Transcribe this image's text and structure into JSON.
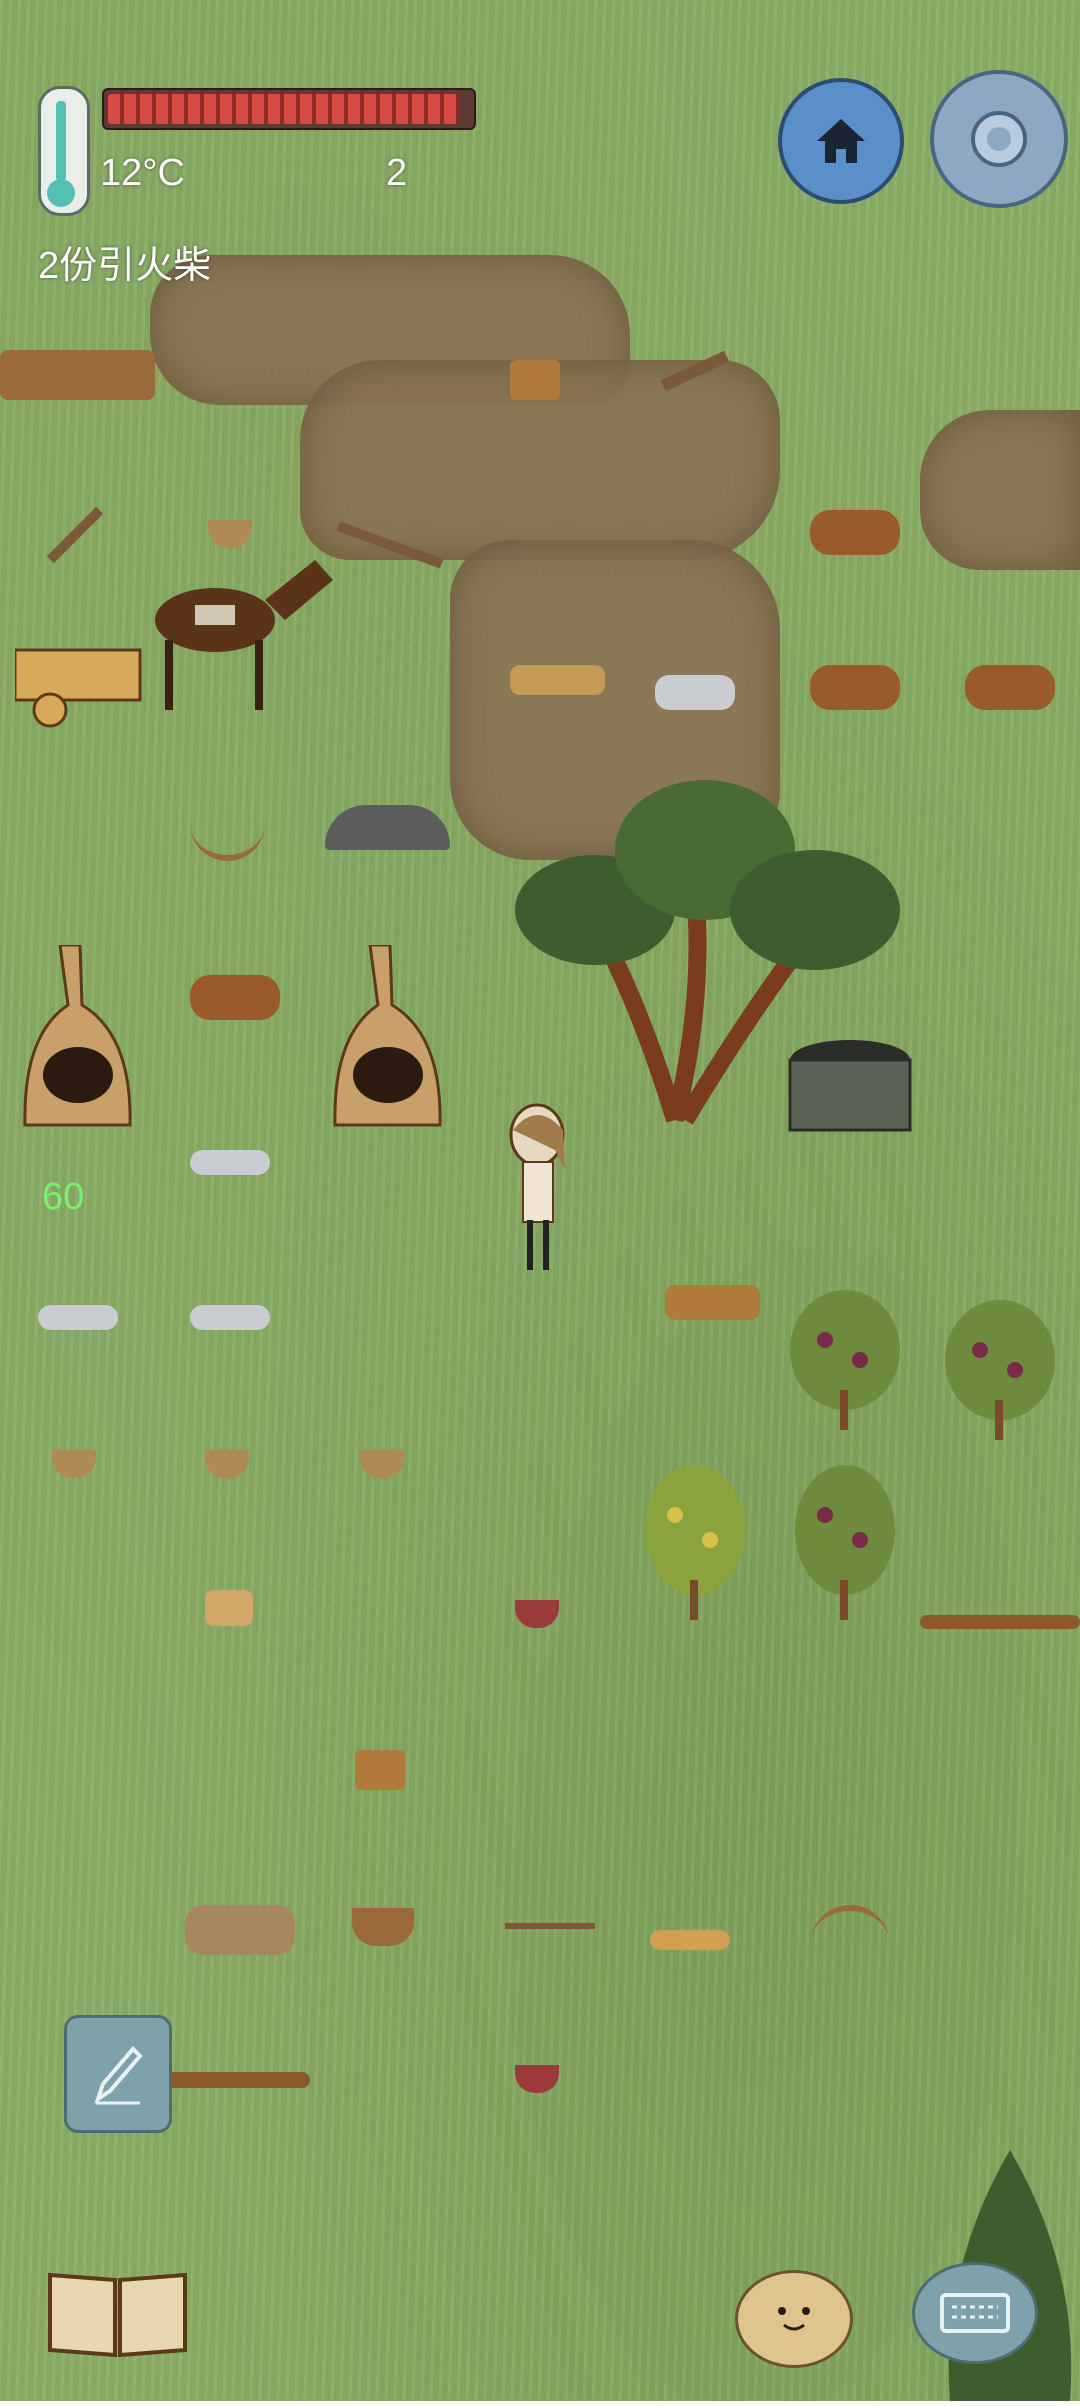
{
  "hud": {
    "temperature": "12°C",
    "count": "2",
    "kindling": "2份引火柴",
    "fps": "60",
    "health_fraction": 0.97
  },
  "icons": {
    "thermometer": "thermometer-icon",
    "home": "home-compass-icon",
    "settings": "gear-icon",
    "pencil": "pencil-icon",
    "book": "book-icon",
    "face": "face-emote-icon",
    "keyboard": "keyboard-chat-icon"
  },
  "colors": {
    "grass": "#8bad66",
    "dirt": "#8b7455",
    "health_red": "#d84a42",
    "fps_green": "#79f070",
    "home_blue": "#5a8fc9"
  }
}
